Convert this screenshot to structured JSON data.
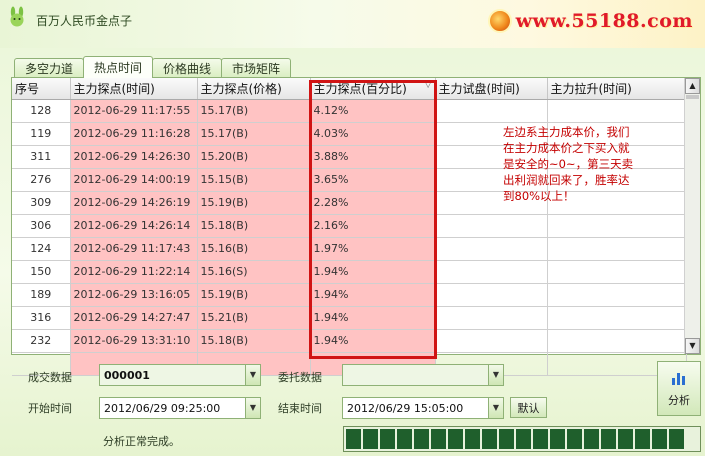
{
  "window": {
    "title": "百万人民币金点子",
    "brand_url": "www.55188.com"
  },
  "tabs": [
    {
      "label": "多空力道",
      "active": false
    },
    {
      "label": "热点时间",
      "active": true
    },
    {
      "label": "价格曲线",
      "active": false
    },
    {
      "label": "市场矩阵",
      "active": false
    }
  ],
  "table": {
    "columns": [
      "序号",
      "主力探点(时间)",
      "主力探点(价格)",
      "主力探点(百分比)",
      "主力试盘(时间)",
      "主力拉升(时间)"
    ],
    "sorted_column_index": 3,
    "rows": [
      [
        "128",
        "2012-06-29 11:17:55",
        "15.17(B)",
        "4.12%",
        "",
        ""
      ],
      [
        "119",
        "2012-06-29 11:16:28",
        "15.17(B)",
        "4.03%",
        "",
        ""
      ],
      [
        "311",
        "2012-06-29 14:26:30",
        "15.20(B)",
        "3.88%",
        "",
        ""
      ],
      [
        "276",
        "2012-06-29 14:00:19",
        "15.15(B)",
        "3.65%",
        "",
        ""
      ],
      [
        "309",
        "2012-06-29 14:26:19",
        "15.19(B)",
        "2.28%",
        "",
        ""
      ],
      [
        "306",
        "2012-06-29 14:26:14",
        "15.18(B)",
        "2.16%",
        "",
        ""
      ],
      [
        "124",
        "2012-06-29 11:17:43",
        "15.16(B)",
        "1.97%",
        "",
        ""
      ],
      [
        "150",
        "2012-06-29 11:22:14",
        "15.16(S)",
        "1.94%",
        "",
        ""
      ],
      [
        "189",
        "2012-06-29 13:16:05",
        "15.19(B)",
        "1.94%",
        "",
        ""
      ],
      [
        "316",
        "2012-06-29 14:27:47",
        "15.21(B)",
        "1.94%",
        "",
        ""
      ],
      [
        "232",
        "2012-06-29 13:31:10",
        "15.18(B)",
        "1.94%",
        "",
        ""
      ],
      [
        "",
        "",
        "",
        "",
        "",
        ""
      ]
    ]
  },
  "annotation": "左边系主力成本价，我们在主力成本价之下买入就是安全的~0~，第三天卖出利润就回来了，胜率达到80%以上！",
  "controls": {
    "trade_data_label": "成交数据",
    "trade_data_value": "000001",
    "order_data_label": "委托数据",
    "order_data_value": "",
    "start_time_label": "开始时间",
    "start_time_value": "2012/06/29 09:25:00",
    "end_time_label": "结束时间",
    "end_time_value": "2012/06/29 15:05:00",
    "default_button": "默认",
    "analyze_button": "分析",
    "status": "分析正常完成。"
  },
  "progress": {
    "value": 1.0,
    "segments": 20
  },
  "colors": {
    "highlight": "#d01414",
    "annotation": "#c40000",
    "pink_cell": "#ffc3c3",
    "progress": "#1f5f2c"
  }
}
